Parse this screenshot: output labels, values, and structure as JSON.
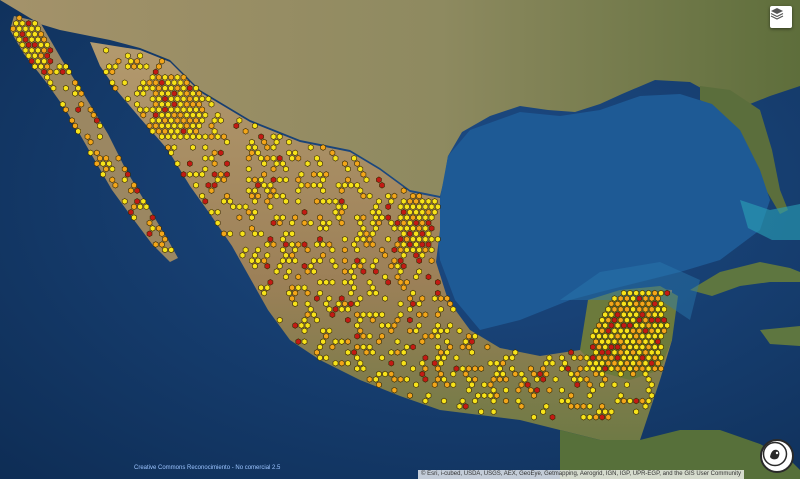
{
  "map": {
    "basemap": "satellite-imagery",
    "region_focus": "Mexico",
    "marker_colors": {
      "frequent": "#f7e31a",
      "mid": "#f3a61a",
      "rare": "#c31a14",
      "outline": "#3a2a00"
    }
  },
  "controls": {
    "layers_icon": "layers-icon"
  },
  "footer": {
    "attribution_left": "Creative Commons Reconocimiento - No comercial 2.5",
    "attribution_right": "© Esri, i-cubed, USDA, USGS, AEX, GeoEye, Getmapping, Aerogrid, IGN, IGP, UPR-EGP, and the GIS User Community"
  },
  "logo": {
    "icon": "institution-seal-icon"
  }
}
